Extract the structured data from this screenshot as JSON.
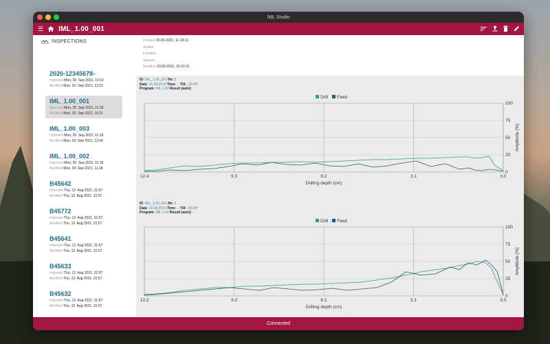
{
  "window": {
    "title": "IML Studio"
  },
  "appbar": {
    "title": "IML_1.00_001",
    "menu_icon": "menu-icon",
    "home_icon": "home-icon",
    "actions": [
      "sort-icon",
      "upload-icon",
      "trash-icon",
      "edit-icon"
    ]
  },
  "sidebar": {
    "header": "INSPECTIONS",
    "items": [
      {
        "name": "2020-12345678-",
        "imported_label": "Imported",
        "imported": "Mon, 20. Sep 2021, 13:13",
        "modified_label": "Modified",
        "modified": "Mon, 20. Sep 2021, 13:13",
        "selected": false
      },
      {
        "name": "IML_1.00_001",
        "imported_label": "Imported",
        "imported": "Mon, 20. Sep 2021, 11:18",
        "modified_label": "Modified",
        "modified": "Mon, 20. Sep 2021, 16:21",
        "selected": true
      },
      {
        "name": "IML_1.00_003",
        "imported_label": "Imported",
        "imported": "Mon, 20. Sep 2021, 11:18",
        "modified_label": "Modified",
        "modified": "Mon, 20. Sep 2021, 12:54",
        "selected": false
      },
      {
        "name": "IML_1.00_002",
        "imported_label": "Imported",
        "imported": "Mon, 20. Sep 2021, 11:18",
        "modified_label": "Modified",
        "modified": "Mon, 20. Sep 2021, 11:18",
        "selected": false
      },
      {
        "name": "B45642",
        "imported_label": "Imported",
        "imported": "Thu, 12. Aug 2021, 21:57",
        "modified_label": "Modified",
        "modified": "Thu, 12. Aug 2021, 21:57",
        "selected": false
      },
      {
        "name": "B45772",
        "imported_label": "Imported",
        "imported": "Thu, 12. Aug 2021, 21:57",
        "modified_label": "Modified",
        "modified": "Thu, 12. Aug 2021, 21:57",
        "selected": false
      },
      {
        "name": "B45641",
        "imported_label": "Imported",
        "imported": "Thu, 12. Aug 2021, 21:57",
        "modified_label": "Modified",
        "modified": "Thu, 12. Aug 2021, 21:57",
        "selected": false
      },
      {
        "name": "B45633",
        "imported_label": "Imported",
        "imported": "Thu, 12. Aug 2021, 21:57",
        "modified_label": "Modified",
        "modified": "Thu, 12. Aug 2021, 21:57",
        "selected": false
      },
      {
        "name": "B45632",
        "imported_label": "Imported",
        "imported": "Thu, 12. Aug 2021, 21:57",
        "modified_label": "Modified",
        "modified": "Thu, 12. Aug 2021, 21:57",
        "selected": false
      }
    ]
  },
  "details": {
    "created_label": "Created",
    "created": "20.09.2021, 11:18:13",
    "auditor_label": "Auditor",
    "auditor": "",
    "location_label": "Location",
    "location": "",
    "species_label": "Species",
    "species": "",
    "modified_label": "Modified",
    "modified": "20.09.2021, 16:21:01"
  },
  "panels": [
    {
      "id_label": "ID",
      "id": "IML_1.00_001",
      "no_label": "No",
      "no": "5",
      "date_label": "Date",
      "date": "16.08.2018",
      "time_label": "Time",
      "time": "--",
      "tilt_label": "Tilt",
      "tilt": "-30.00°",
      "program_label": "Program",
      "program": "IML 1.00",
      "result_label": "Result (auto)",
      "result": ""
    },
    {
      "id_label": "ID",
      "id": "IML_1.00_001",
      "no_label": "No",
      "no": "4",
      "date_label": "Date",
      "date": "16.08.2018",
      "time_label": "Time",
      "time": "--",
      "tilt_label": "Tilt",
      "tilt": "-30.90°",
      "program_label": "Program",
      "program": "IML 1.00",
      "result_label": "Result (auto)",
      "result": "-"
    }
  ],
  "colors": {
    "accent": "#a3163f",
    "drill": "#2e9c8a",
    "feed": "#1f5a7a",
    "link": "#1d6d8c"
  },
  "chart_data": [
    {
      "type": "line",
      "legend": [
        "Drill",
        "Feed"
      ],
      "xlabel": "Drilling depth (cm)",
      "ylabel": "Amplitude (%)",
      "xlim": [
        12.4,
        0.0
      ],
      "ylim": [
        0,
        100
      ],
      "xticks": [
        "12.4",
        "9.3",
        "6.2",
        "3.1",
        "0.0"
      ],
      "yticks": [
        "0",
        "25",
        "50",
        "75",
        "100"
      ],
      "grid": true,
      "series": [
        {
          "name": "Drill",
          "x": [
            12.4,
            12.0,
            11.5,
            11.0,
            10.5,
            10.0,
            9.5,
            9.0,
            8.5,
            8.0,
            7.5,
            7.0,
            6.5,
            6.0,
            5.5,
            5.0,
            4.5,
            4.0,
            3.5,
            3.0,
            2.5,
            2.0,
            1.5,
            1.2,
            1.0,
            0.7,
            0.5,
            0.3,
            0.0
          ],
          "y": [
            2,
            3,
            6,
            9,
            8,
            10,
            12,
            13,
            13,
            14,
            14,
            15,
            14,
            15,
            16,
            17,
            18,
            18,
            19,
            20,
            20,
            21,
            22,
            22,
            20,
            21,
            23,
            10,
            2
          ]
        },
        {
          "name": "Feed",
          "x": [
            12.4,
            12.0,
            11.5,
            11.0,
            10.5,
            10.0,
            9.5,
            9.0,
            8.5,
            8.0,
            7.5,
            7.0,
            6.5,
            6.0,
            5.5,
            5.0,
            4.5,
            4.0,
            3.5,
            3.0,
            2.5,
            2.0,
            1.5,
            1.2,
            1.0,
            0.7,
            0.5,
            0.3,
            0.0
          ],
          "y": [
            1,
            1,
            3,
            2,
            4,
            5,
            8,
            12,
            10,
            14,
            11,
            10,
            13,
            9,
            8,
            12,
            7,
            9,
            13,
            16,
            8,
            12,
            4,
            6,
            3,
            2,
            4,
            3,
            1
          ]
        }
      ]
    },
    {
      "type": "line",
      "legend": [
        "Drill",
        "Feed"
      ],
      "xlabel": "Drilling depth (cm)",
      "ylabel": "Amplitude (%)",
      "xlim": [
        12.2,
        0.0
      ],
      "ylim": [
        0,
        100
      ],
      "xticks": [
        "12.2",
        "9.2",
        "6.1",
        "3.1",
        "0.0"
      ],
      "yticks": [
        "0",
        "25",
        "50",
        "75",
        "100"
      ],
      "grid": true,
      "series": [
        {
          "name": "Drill",
          "x": [
            12.2,
            11.8,
            11.3,
            10.8,
            10.3,
            9.8,
            9.3,
            8.8,
            8.3,
            7.8,
            7.3,
            6.8,
            6.3,
            5.8,
            5.3,
            4.8,
            4.3,
            3.8,
            3.3,
            2.8,
            2.3,
            1.8,
            1.5,
            1.2,
            0.9,
            0.6,
            0.4,
            0.2,
            0.0
          ],
          "y": [
            2,
            3,
            5,
            8,
            10,
            12,
            12,
            14,
            14,
            15,
            16,
            17,
            17,
            18,
            19,
            20,
            23,
            26,
            30,
            35,
            38,
            41,
            44,
            46,
            50,
            48,
            40,
            20,
            2
          ]
        },
        {
          "name": "Feed",
          "x": [
            12.2,
            11.8,
            11.3,
            10.8,
            10.3,
            9.8,
            9.3,
            8.8,
            8.3,
            7.8,
            7.3,
            6.8,
            6.3,
            5.8,
            5.3,
            4.8,
            4.3,
            3.8,
            3.3,
            2.8,
            2.3,
            1.8,
            1.5,
            1.2,
            0.9,
            0.6,
            0.4,
            0.2,
            0.0
          ],
          "y": [
            1,
            2,
            4,
            6,
            8,
            10,
            12,
            10,
            8,
            12,
            10,
            8,
            9,
            11,
            8,
            10,
            12,
            20,
            35,
            30,
            32,
            42,
            38,
            48,
            45,
            52,
            45,
            35,
            1
          ]
        }
      ]
    }
  ]
}
